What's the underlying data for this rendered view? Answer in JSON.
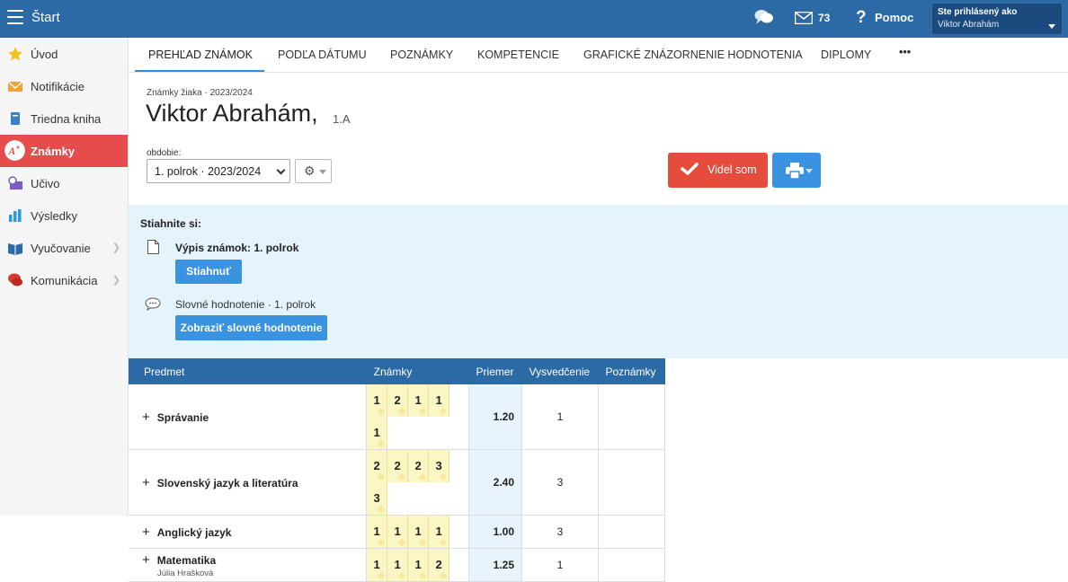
{
  "topbar": {
    "title": "Štart",
    "mail_count": "73",
    "help_label": "Pomoc",
    "user_label": "Ste prihlásený ako",
    "user_name": "Viktor Abrahám",
    "color": "#2c6aa6"
  },
  "sidebar": {
    "items": [
      {
        "label": "Úvod",
        "icon": "star-icon"
      },
      {
        "label": "Notifikácie",
        "icon": "envelope-icon"
      },
      {
        "label": "Triedna kniha",
        "icon": "book-icon"
      },
      {
        "label": "Známky",
        "icon": "grade-icon",
        "active": true
      },
      {
        "label": "Učivo",
        "icon": "lesson-icon"
      },
      {
        "label": "Výsledky",
        "icon": "bar-chart-icon"
      },
      {
        "label": "Vyučovanie",
        "icon": "open-book-icon",
        "has_submenu": true
      },
      {
        "label": "Komunikácia",
        "icon": "chat-icon",
        "has_submenu": true
      }
    ],
    "active_color": "#e64c4c"
  },
  "tabs": [
    {
      "label": "PREHĽAD ZNÁMOK",
      "active": true
    },
    {
      "label": "PODĽA DÁTUMU"
    },
    {
      "label": "POZNÁMKY"
    },
    {
      "label": "KOMPETENCIE"
    },
    {
      "label": "GRAFICKÉ ZNÁZORNENIE HODNOTENIA"
    },
    {
      "label": "DIPLOMY"
    },
    {
      "label": "•••"
    }
  ],
  "header": {
    "breadcrumb": "Známky žiaka · 2023/2024",
    "student_name": "Viktor Abrahám,",
    "student_class": "1.A"
  },
  "period": {
    "label": "obdobie:",
    "selected": "1. polrok · 2023/2024"
  },
  "actions": {
    "videl_label": "Videl som"
  },
  "download": {
    "title": "Stiahnite si:",
    "item1_label": "Výpis známok: 1. polrok",
    "item1_button": "Stiahnuť",
    "item2_label": "Slovné hodnotenie · 1. polrok",
    "item2_button": "Zobraziť slovné hodnotenie"
  },
  "table": {
    "headers": [
      "Predmet",
      "Známky",
      "Priemer",
      "Vysvedčenie",
      "Poznámky"
    ],
    "rows": [
      {
        "subject": "Správanie",
        "teacher": "",
        "grades": [
          "1",
          "2",
          "1",
          "1",
          "1"
        ],
        "average": "1.20",
        "certificate": "1",
        "note": ""
      },
      {
        "subject": "Slovenský jazyk a literatúra",
        "teacher": "",
        "grades": [
          "2",
          "2",
          "2",
          "3",
          "3"
        ],
        "average": "2.40",
        "certificate": "3",
        "note": ""
      },
      {
        "subject": "Anglický jazyk",
        "teacher": "",
        "grades": [
          "1",
          "1",
          "1",
          "1"
        ],
        "average": "1.00",
        "certificate": "3",
        "note": ""
      },
      {
        "subject": "Matematika",
        "teacher": "Júlia Hrašková",
        "grades": [
          "1",
          "1",
          "1",
          "2"
        ],
        "average": "1.25",
        "certificate": "1",
        "note": ""
      }
    ]
  }
}
